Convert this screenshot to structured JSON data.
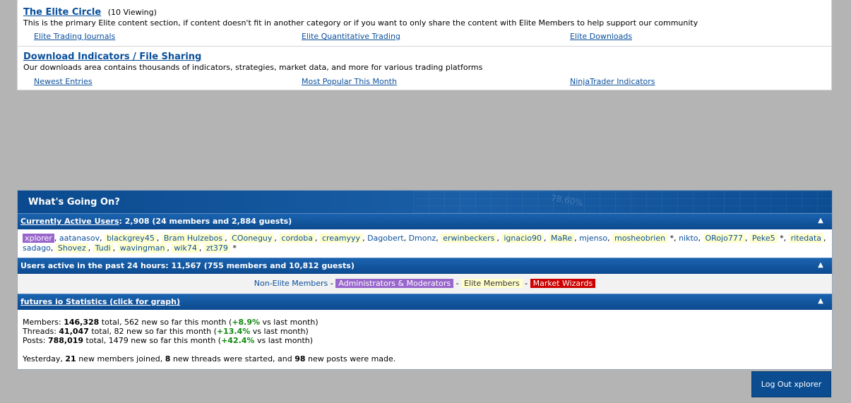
{
  "forums": [
    {
      "title": "The Elite Circle",
      "viewing": "(10 Viewing)",
      "description": "This is the primary Elite content section, if content doesn't fit in another category or if you want to only share the content with Elite Members to help support our community",
      "links": [
        "Elite Trading Journals",
        "Elite Quantitative Trading",
        "Elite Downloads"
      ]
    },
    {
      "title": "Download Indicators / File Sharing",
      "viewing": "",
      "description": "Our downloads area contains thousands of indicators, strategies, market data, and more for various trading platforms",
      "links": [
        "Newest Entries",
        "Most Popular This Month",
        "NinjaTrader Indicators"
      ]
    }
  ],
  "wgo": {
    "title": "What's Going On?",
    "watermark": "78.60%",
    "active_users": {
      "link": "Currently Active Users",
      "text": ": 2,908 (24 members and 2,884 guests)"
    },
    "users": [
      {
        "name": "xplorer",
        "type": "admin",
        "sep": ", "
      },
      {
        "name": "aatanasov",
        "type": "plain",
        "sep": ", "
      },
      {
        "name": "blackgrey45",
        "type": "elite",
        "sep": ", "
      },
      {
        "name": "Bram Hulzebos",
        "type": "elite",
        "sep": ", "
      },
      {
        "name": "COoneguy",
        "type": "elite",
        "sep": ", "
      },
      {
        "name": "cordoba",
        "type": "elite",
        "sep": ", "
      },
      {
        "name": "creamyyy",
        "type": "elite",
        "sep": ", "
      },
      {
        "name": "Dagobert",
        "type": "plain",
        "sep": ", "
      },
      {
        "name": "Dmonz",
        "type": "plain",
        "sep": ", "
      },
      {
        "name": "erwinbeckers",
        "type": "elite",
        "sep": ", "
      },
      {
        "name": "ignacio90",
        "type": "elite",
        "sep": ", "
      },
      {
        "name": "MaRe",
        "type": "elite",
        "sep": ", "
      },
      {
        "name": "mjenso",
        "type": "plain",
        "sep": ", "
      },
      {
        "name": "mosheobrien",
        "type": "elite",
        "sep": " *, "
      },
      {
        "name": "nikto",
        "type": "plain",
        "sep": ", "
      },
      {
        "name": "ORojo777",
        "type": "elite",
        "sep": ", "
      },
      {
        "name": "Peke5",
        "type": "elite",
        "sep": " *, "
      },
      {
        "name": "ritedata",
        "type": "elite",
        "sep": ", "
      },
      {
        "name": "sadago",
        "type": "plain",
        "sep": ", "
      },
      {
        "name": "Shovez",
        "type": "elite",
        "sep": ", "
      },
      {
        "name": "Tudi",
        "type": "elite",
        "sep": ", "
      },
      {
        "name": "wavingman",
        "type": "elite",
        "sep": ", "
      },
      {
        "name": "wik74",
        "type": "elite",
        "sep": ", "
      },
      {
        "name": "zt379",
        "type": "elite",
        "sep": " *"
      }
    ],
    "past24": "Users active in the past 24 hours: 11,567 (755 members and 10,812 guests)",
    "legend": {
      "non_elite": "Non-Elite Members",
      "admins": "Administrators & Moderators",
      "elite": "Elite Members",
      "wizards": "Market Wizards",
      "sep": " - "
    },
    "stats_bar": "futures io Statistics (click for graph)",
    "stats": {
      "members_label": "Members: ",
      "members_total": "146,328",
      "members_mid": " total, 562 new so far this month (",
      "members_pct": "+8.9%",
      "members_end": " vs last month)",
      "threads_label": "Threads: ",
      "threads_total": "41,047",
      "threads_mid": " total, 82 new so far this month (",
      "threads_pct": "+13.4%",
      "threads_end": " vs last month)",
      "posts_label": "Posts: ",
      "posts_total": "788,019",
      "posts_mid": " total, 1479 new so far this month (",
      "posts_pct": "+42.4%",
      "posts_end": " vs last month)",
      "yesterday_a": "Yesterday, ",
      "yesterday_members": "21",
      "yesterday_b": " new members joined, ",
      "yesterday_threads": "8",
      "yesterday_c": " new threads were started, and ",
      "yesterday_posts": "98",
      "yesterday_d": " new posts were made."
    }
  },
  "logout_label": "Log Out xplorer",
  "collapse_icon": "chevron-up-icon"
}
